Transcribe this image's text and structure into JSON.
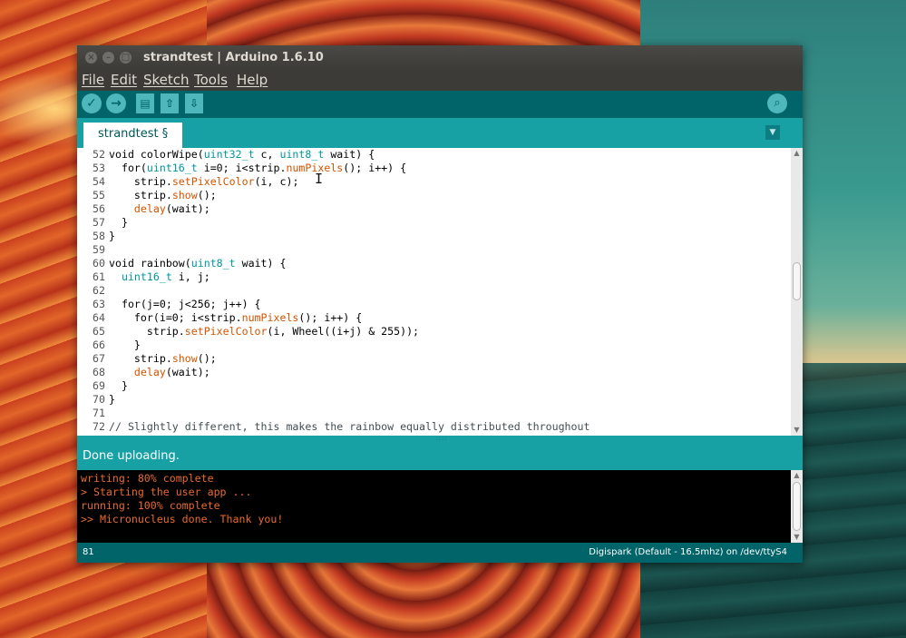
{
  "window": {
    "title": "strandtest | Arduino 1.6.10",
    "close_glyph": "×",
    "minimize_glyph": "–",
    "maximize_glyph": "□"
  },
  "menu": {
    "items": [
      "File",
      "Edit",
      "Sketch",
      "Tools",
      "Help"
    ]
  },
  "toolbar": {
    "verify_icon": "✓",
    "upload_icon": "→",
    "new_icon": "▤",
    "open_icon": "⇧",
    "save_icon": "⇩",
    "serial_monitor_icon": "⌕"
  },
  "tabs": {
    "active_label": "strandtest §",
    "menu_icon": "▼"
  },
  "editor": {
    "lines": [
      {
        "n": "52",
        "segments": [
          {
            "t": "void colorWipe(",
            "c": ""
          },
          {
            "t": "uint32_t",
            "c": "ty"
          },
          {
            "t": " c, ",
            "c": ""
          },
          {
            "t": "uint8_t",
            "c": "ty"
          },
          {
            "t": " wait) {",
            "c": ""
          }
        ]
      },
      {
        "n": "53",
        "segments": [
          {
            "t": "  for(",
            "c": ""
          },
          {
            "t": "uint16_t",
            "c": "ty"
          },
          {
            "t": " i=0; i<strip.",
            "c": ""
          },
          {
            "t": "numPixels",
            "c": "fn"
          },
          {
            "t": "(); i++) {",
            "c": ""
          }
        ]
      },
      {
        "n": "54",
        "segments": [
          {
            "t": "    strip.",
            "c": ""
          },
          {
            "t": "setPixelColor",
            "c": "fn"
          },
          {
            "t": "(i, c);",
            "c": ""
          }
        ]
      },
      {
        "n": "55",
        "segments": [
          {
            "t": "    strip.",
            "c": ""
          },
          {
            "t": "show",
            "c": "fn"
          },
          {
            "t": "();",
            "c": ""
          }
        ]
      },
      {
        "n": "56",
        "segments": [
          {
            "t": "    ",
            "c": ""
          },
          {
            "t": "delay",
            "c": "fn"
          },
          {
            "t": "(wait);",
            "c": ""
          }
        ]
      },
      {
        "n": "57",
        "segments": [
          {
            "t": "  }",
            "c": ""
          }
        ]
      },
      {
        "n": "58",
        "segments": [
          {
            "t": "}",
            "c": ""
          }
        ]
      },
      {
        "n": "59",
        "segments": []
      },
      {
        "n": "60",
        "segments": [
          {
            "t": "void rainbow(",
            "c": ""
          },
          {
            "t": "uint8_t",
            "c": "ty"
          },
          {
            "t": " wait) {",
            "c": ""
          }
        ]
      },
      {
        "n": "61",
        "segments": [
          {
            "t": "  ",
            "c": ""
          },
          {
            "t": "uint16_t",
            "c": "ty"
          },
          {
            "t": " i, j;",
            "c": ""
          }
        ]
      },
      {
        "n": "62",
        "segments": []
      },
      {
        "n": "63",
        "segments": [
          {
            "t": "  for(j=0; j<256; j++) {",
            "c": ""
          }
        ]
      },
      {
        "n": "64",
        "segments": [
          {
            "t": "    for(i=0; i<strip.",
            "c": ""
          },
          {
            "t": "numPixels",
            "c": "fn"
          },
          {
            "t": "(); i++) {",
            "c": ""
          }
        ]
      },
      {
        "n": "65",
        "segments": [
          {
            "t": "      strip.",
            "c": ""
          },
          {
            "t": "setPixelColor",
            "c": "fn"
          },
          {
            "t": "(i, Wheel((i+j) & 255));",
            "c": ""
          }
        ]
      },
      {
        "n": "66",
        "segments": [
          {
            "t": "    }",
            "c": ""
          }
        ]
      },
      {
        "n": "67",
        "segments": [
          {
            "t": "    strip.",
            "c": ""
          },
          {
            "t": "show",
            "c": "fn"
          },
          {
            "t": "();",
            "c": ""
          }
        ]
      },
      {
        "n": "68",
        "segments": [
          {
            "t": "    ",
            "c": ""
          },
          {
            "t": "delay",
            "c": "fn"
          },
          {
            "t": "(wait);",
            "c": ""
          }
        ]
      },
      {
        "n": "69",
        "segments": [
          {
            "t": "  }",
            "c": ""
          }
        ]
      },
      {
        "n": "70",
        "segments": [
          {
            "t": "}",
            "c": ""
          }
        ]
      },
      {
        "n": "71",
        "segments": []
      },
      {
        "n": "72",
        "segments": [
          {
            "t": "// Slightly different, this makes the rainbow equally distributed throughout",
            "c": "cm"
          }
        ]
      }
    ],
    "cursor_glyph": "I",
    "scroll_up": "▲",
    "scroll_down": "▼"
  },
  "splitter": {
    "grip": "::::"
  },
  "status": {
    "message": "Done uploading."
  },
  "console": {
    "lines": [
      "writing: 80% complete",
      "> Starting the user app ...",
      "running: 100% complete",
      ">> Micronucleus done. Thank you!"
    ],
    "scroll_up": "▲",
    "scroll_down": "▼"
  },
  "footer": {
    "line_number": "81",
    "board": "Digispark (Default - 16.5mhz) on /dev/ttyS4"
  },
  "colors": {
    "accent_dark": "#006468",
    "accent": "#17a1a5",
    "keyword_type": "#00979c",
    "function": "#d35400",
    "console_text": "#e86a2f"
  }
}
